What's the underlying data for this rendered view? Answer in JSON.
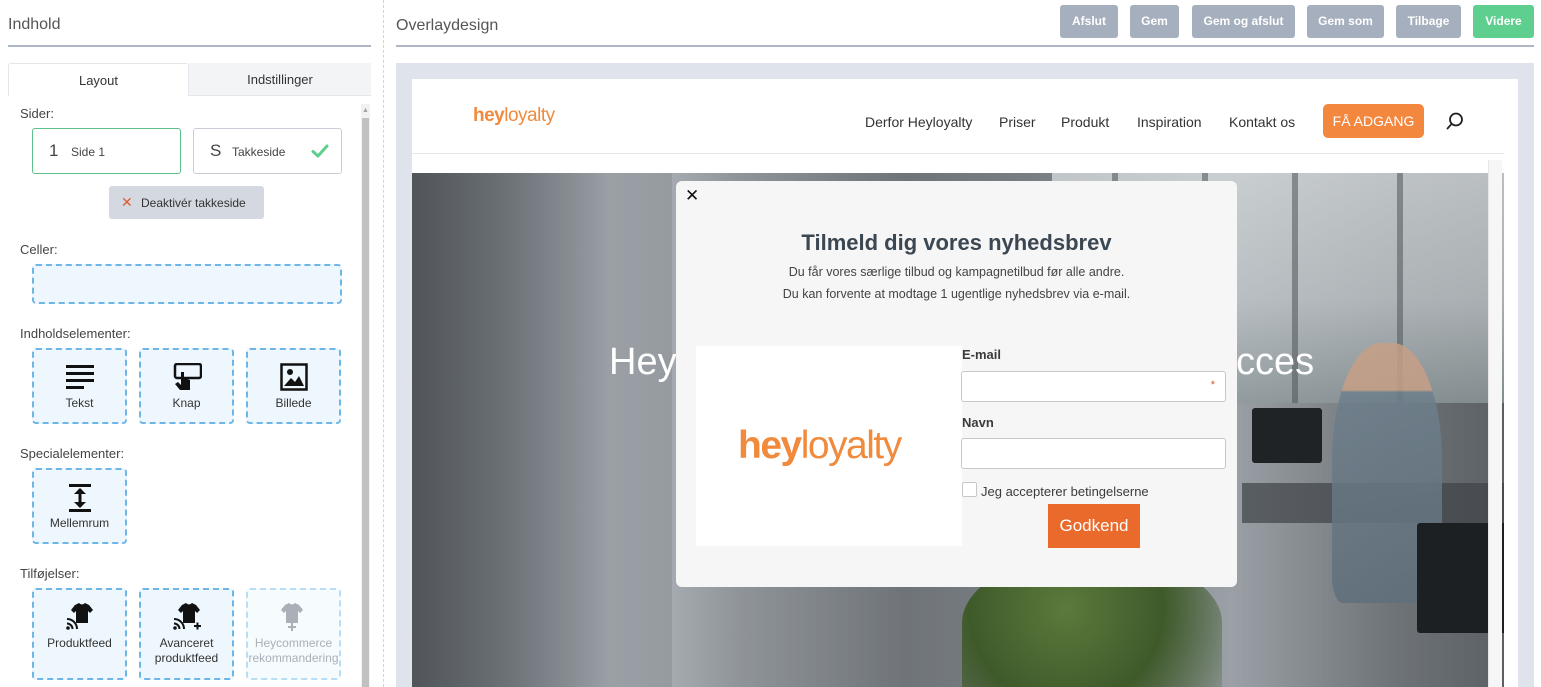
{
  "left_panel": {
    "title": "Indhold",
    "tabs": [
      {
        "label": "Layout"
      },
      {
        "label": "Indstillinger"
      }
    ],
    "pages_label": "Sider:",
    "pages": [
      {
        "number": "1",
        "name": "Side 1"
      },
      {
        "number": "S",
        "name": "Takkeside",
        "status_icon": "check-icon"
      }
    ],
    "deactivate_button": "Deaktivér takkeside",
    "cells_label": "Celler:",
    "content_elements_label": "Indholdselementer:",
    "content_elements": [
      {
        "label": "Tekst",
        "icon": "text-lines-icon"
      },
      {
        "label": "Knap",
        "icon": "button-click-icon"
      },
      {
        "label": "Billede",
        "icon": "image-icon"
      }
    ],
    "special_elements_label": "Specialelementer:",
    "special_elements": [
      {
        "label": "Mellemrum",
        "icon": "spacer-icon"
      }
    ],
    "addons_label": "Tilføjelser:",
    "addons": [
      {
        "label": "Produktfeed",
        "icon": "product-feed-icon",
        "enabled": true
      },
      {
        "label": "Avanceret produktfeed",
        "line1": "Avanceret",
        "line2": "produktfeed",
        "icon": "advanced-product-feed-icon",
        "enabled": true
      },
      {
        "label": "Heycommerce rekommandering",
        "line1": "Heycommerce",
        "line2": "rekommandering",
        "icon": "recommendation-icon",
        "enabled": false
      }
    ]
  },
  "right_panel": {
    "title": "Overlaydesign",
    "toolbar": {
      "exit": "Afslut",
      "save": "Gem",
      "save_and_exit": "Gem og afslut",
      "save_as": "Gem som",
      "back": "Tilbage",
      "next": "Videre"
    }
  },
  "preview": {
    "site": {
      "logo_part1": "hey",
      "logo_part2": "loyalty",
      "nav": [
        "Derfor Heyloyalty",
        "Priser",
        "Produkt",
        "Inspiration",
        "Kontakt os"
      ],
      "cta": "FÅ ADGANG",
      "hero_left": "Hey",
      "hero_right": "cces"
    },
    "popup": {
      "heading": "Tilmeld dig vores nyhedsbrev",
      "subtext_1": "Du får vores særlige tilbud og kampagnetilbud før alle andre.",
      "subtext_2": "Du kan forvente at modtage 1 ugentlige nyhedsbrev via e-mail.",
      "logo_part1": "hey",
      "logo_part2": "loyalty",
      "email_label": "E-mail",
      "email_required_mark": "*",
      "name_label": "Navn",
      "terms_label": "Jeg accepterer betingelserne",
      "submit": "Godkend"
    }
  },
  "colors": {
    "accent_green": "#5ecf8e",
    "toolbar_gray": "#a6afbd",
    "drop_blue": "#6cb6e8",
    "brand_orange": "#f08a3c",
    "submit_orange": "#ea6a2c"
  }
}
